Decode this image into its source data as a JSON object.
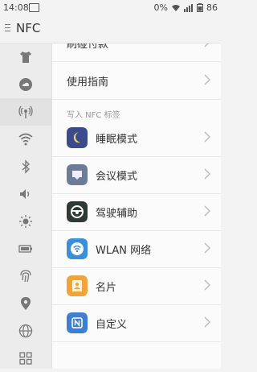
{
  "status": {
    "time": "14:08",
    "battery_pct": "0%",
    "battery_num": "86"
  },
  "title": "NFC",
  "rows": [
    {
      "label": "刷碰付款"
    },
    {
      "label": "使用指南"
    }
  ],
  "section_title": "写入 NFC 标签",
  "tags": [
    {
      "label": "睡眠模式",
      "icon": "moon-icon",
      "color": "#3c4a8e"
    },
    {
      "label": "会议模式",
      "icon": "meeting-icon",
      "color": "#6b7b98"
    },
    {
      "label": "驾驶辅助",
      "icon": "steering-wheel-icon",
      "color": "#2f3a35"
    },
    {
      "label": "WLAN 网络",
      "icon": "wifi-icon",
      "color": "#3b8fd8"
    },
    {
      "label": "名片",
      "icon": "contact-card-icon",
      "color": "#f0a43a"
    },
    {
      "label": "自定义",
      "icon": "nfc-icon",
      "color": "#3e7fd2"
    }
  ],
  "sidebar": [
    "shirt-icon",
    "cloud-icon",
    "nfc-signal-icon",
    "wifi-icon",
    "bluetooth-icon",
    "volume-icon",
    "brightness-icon",
    "battery-icon",
    "fingerprint-icon",
    "location-icon",
    "globe-icon",
    "apps-grid-icon"
  ]
}
